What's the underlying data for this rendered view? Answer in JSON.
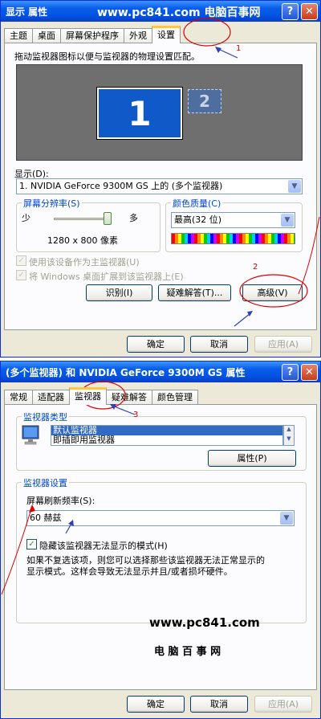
{
  "dialog1": {
    "title": "显示 属性",
    "watermark": "www.pc841.com 电脑百事网",
    "help_glyph": "?",
    "close_glyph": "✕",
    "tabs": [
      "主题",
      "桌面",
      "屏幕保护程序",
      "外观",
      "设置"
    ],
    "instruction": "拖动监视器图标以便与监视器的物理设置匹配。",
    "monitor_primary": "1",
    "monitor_secondary": "2",
    "display_label": "显示(D):",
    "display_value": "1. NVIDIA GeForce 9300M GS 上的 (多个监视器)",
    "resolution_group": "屏幕分辨率(S)",
    "res_less": "少",
    "res_more": "多",
    "resolution_value": "1280 x 800 像素",
    "color_group": "颜色质量(C)",
    "color_value": "最高(32 位)",
    "primary_checkbox": "使用该设备作为主监视器(U)",
    "extend_checkbox": "将 Windows 桌面扩展到该监视器上(E)",
    "identify_button": "识别(I)",
    "troubleshoot_button": "疑难解答(T)...",
    "advanced_button": "高级(V)",
    "ok": "确定",
    "cancel": "取消",
    "apply": "应用(A)"
  },
  "dialog2": {
    "title": "(多个监视器) 和 NVIDIA GeForce 9300M GS 属性",
    "help_glyph": "?",
    "close_glyph": "✕",
    "tabs": [
      "常规",
      "适配器",
      "监视器",
      "疑难解答",
      "颜色管理"
    ],
    "monitor_type_group": "监视器类型",
    "monitor_list": [
      "默认监视器",
      "即插即用监视器"
    ],
    "properties_button": "属性(P)",
    "monitor_settings_group": "监视器设置",
    "refresh_label": "屏幕刷新频率(S):",
    "refresh_value": "60 赫兹",
    "hide_modes_checkbox": "隐藏该监视器无法显示的模式(H)",
    "hide_modes_line1": "如果不复选该项，则您可以选择那些该监视器无法正常显示的",
    "hide_modes_line2": "显示模式。这样会导致无法显示并且/或者损坏硬件。",
    "watermark_url": "www.pc841.com",
    "watermark_name": "电 脑 百 事 网",
    "ok": "确定",
    "cancel": "取消",
    "apply": "应用(A)"
  },
  "annotations": {
    "step1": "1",
    "step2": "2",
    "step3": "3"
  },
  "colors": {
    "titlebar": "#0054E3",
    "dialog_bg": "#ECE9D8",
    "desktop_preview": "#6F6F6F",
    "monitor_blue": "#0F5AC8",
    "tab_highlight": "#FFC83C",
    "annotation_red": "#E00000",
    "annotation_arrow": "#2B3FBF"
  }
}
